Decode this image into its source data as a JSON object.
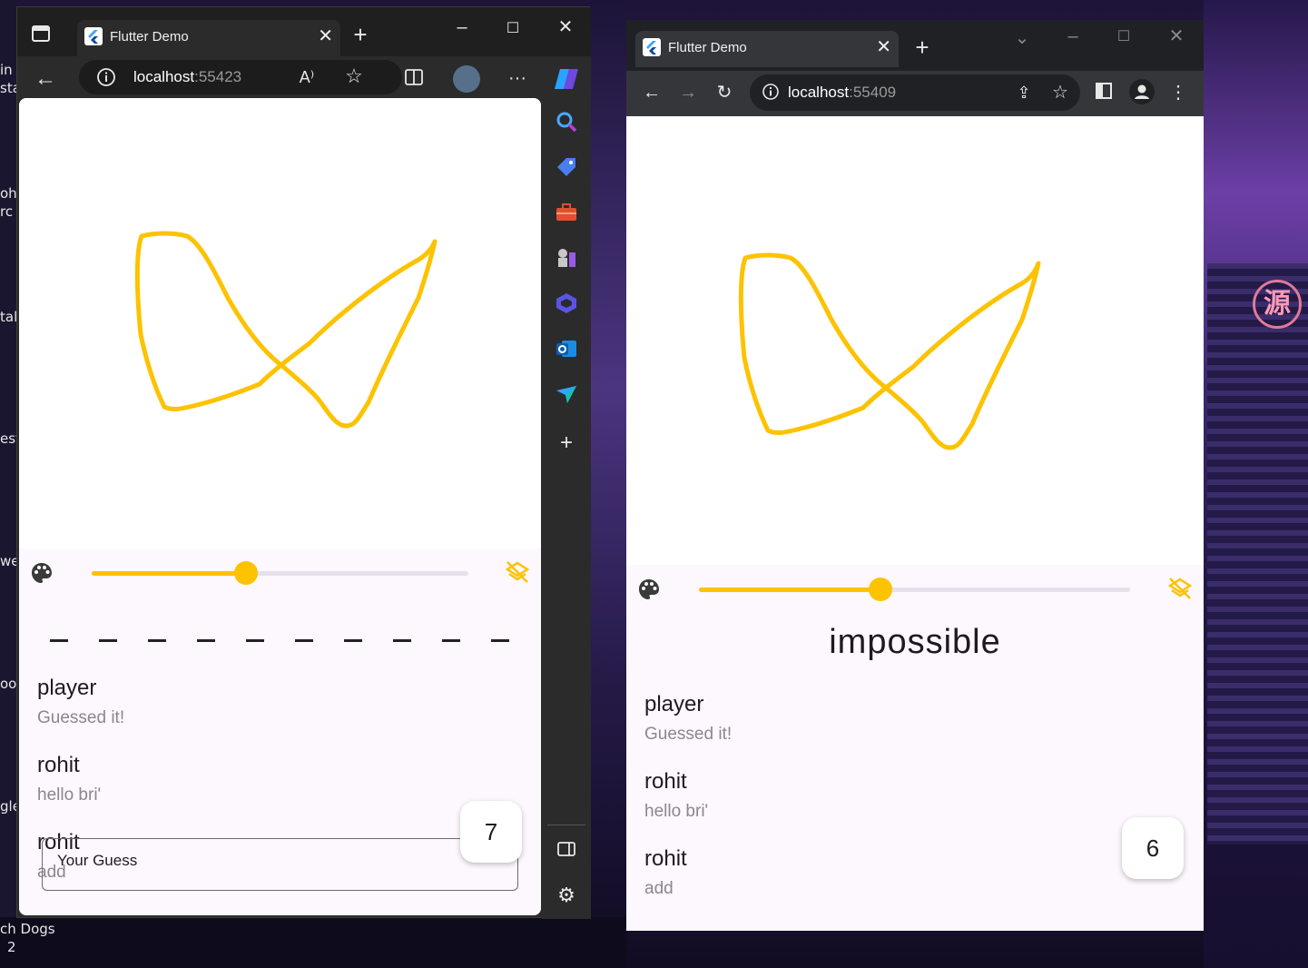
{
  "desktop": {
    "labels": [
      "in",
      "sta",
      "oh",
      "rc",
      "tal",
      "est",
      "we",
      "oo",
      "gle",
      "ch Dogs",
      "2"
    ],
    "seal_char": "源"
  },
  "left_window": {
    "browser": "edge",
    "tab_title": "Flutter Demo",
    "url_host": "localhost",
    "url_port": ":55423",
    "new_tab": "+",
    "back": "←",
    "more": "···",
    "app": {
      "hint_blanks": 10,
      "slider_value": 0.41,
      "messages": [
        {
          "name": "player",
          "text": "Guessed it!"
        },
        {
          "name": "rohit",
          "text": "hello bri'"
        },
        {
          "name": "rohit",
          "text": "add"
        }
      ],
      "timer": "7",
      "guess_placeholder": "Your Guess"
    }
  },
  "right_window": {
    "browser": "chrome",
    "tab_title": "Flutter Demo",
    "url_host": "localhost",
    "url_port": ":55409",
    "new_tab": "+",
    "app": {
      "word": "impossible",
      "slider_value": 0.42,
      "messages": [
        {
          "name": "player",
          "text": "Guessed it!"
        },
        {
          "name": "rohit",
          "text": "hello bri'"
        },
        {
          "name": "rohit",
          "text": "add"
        }
      ],
      "timer": "6"
    }
  },
  "colors": {
    "accent": "#fdc200",
    "stroke": "#fdc200"
  }
}
